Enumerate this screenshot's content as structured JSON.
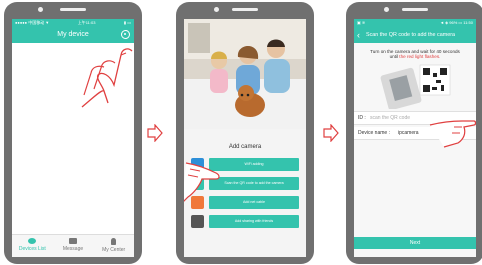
{
  "screen1": {
    "status_left": "●●●●● 中国移动 ▼",
    "status_time": "上午11:03",
    "status_right": "▮ ▭",
    "title": "My device",
    "tabs": [
      "Devices List",
      "Message",
      "My Center"
    ]
  },
  "screen2": {
    "title": "Add camera",
    "options": [
      "WiFi adding",
      "Scan the QR code to add the camera",
      "Add net cable",
      "Add sharing with friends"
    ],
    "icon_colors": [
      "#2d8fd8",
      "#34c3ad",
      "#f0783a",
      "#555555"
    ]
  },
  "screen3": {
    "status_left": "▣ ≋",
    "status_right": "◄ ◈ 96% ▭ 11:50",
    "title": "Scan the QR code to add the camera",
    "instruction_line1": "Turn on the camera and wait for 40 seconds",
    "instruction_pre": "until ",
    "instruction_highlight": "the red light flashes.",
    "id_label": "ID :",
    "id_placeholder": "scan the QR code",
    "name_label": "Device name :",
    "name_value": "ipcamera",
    "next_label": "Next"
  },
  "colors": {
    "accent": "#34c3ad",
    "highlight_text": "#e04040",
    "arrow": "#e04040"
  },
  "icons": [
    "settings-icon",
    "back-arrow-icon",
    "step-arrow-icon"
  ]
}
